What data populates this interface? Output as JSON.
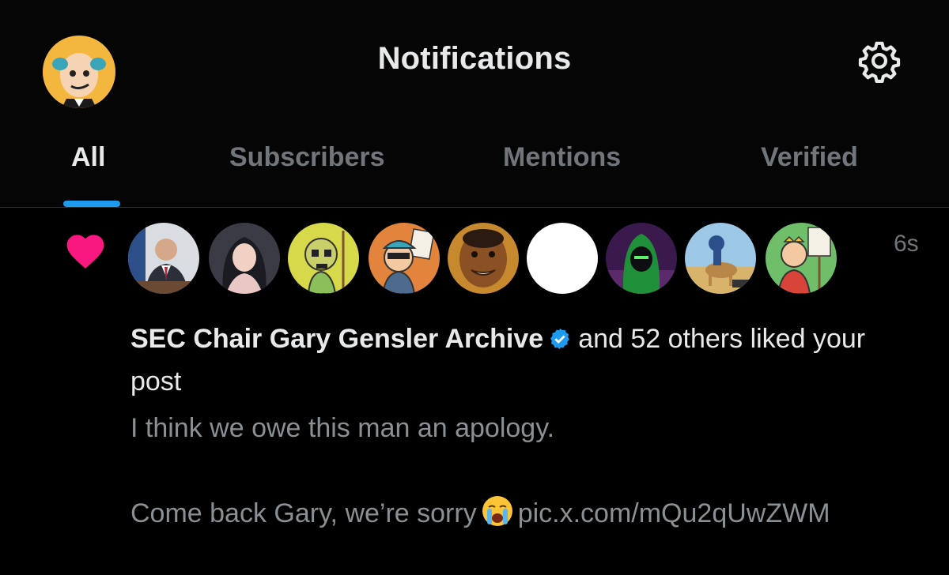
{
  "header": {
    "title": "Notifications",
    "avatar": "cartoon-avatar",
    "settings_icon": "gear-icon"
  },
  "tabs": [
    {
      "label": "All",
      "active": true
    },
    {
      "label": "Subscribers",
      "active": false
    },
    {
      "label": "Mentions",
      "active": false
    },
    {
      "label": "Verified",
      "active": false
    }
  ],
  "colors": {
    "accent": "#1d9bf0",
    "like": "#f91880",
    "muted": "#71767b",
    "text": "#e7e9ea"
  },
  "notification": {
    "type_icon": "heart-icon",
    "time": "6s",
    "actor_name": "SEC Chair Gary Gensler Archive",
    "verified_icon": "verified-badge-icon",
    "action_text": "and 52 others liked your post",
    "post_line1": "I think we owe this man an apology.",
    "post_line2": "Come back Gary, we’re sorry",
    "post_emoji": "crying-face-emoji",
    "post_link": "pic.x.com/mQu2qUwZWM",
    "liker_avatars": [
      "avatar-man-in-suit",
      "avatar-woman-photo",
      "avatar-yellow-robot",
      "avatar-cartoon-sign",
      "avatar-painted-face",
      "avatar-blank-white",
      "avatar-green-hooded-figure",
      "avatar-desert-camel",
      "avatar-cartoon-sign-2"
    ]
  }
}
